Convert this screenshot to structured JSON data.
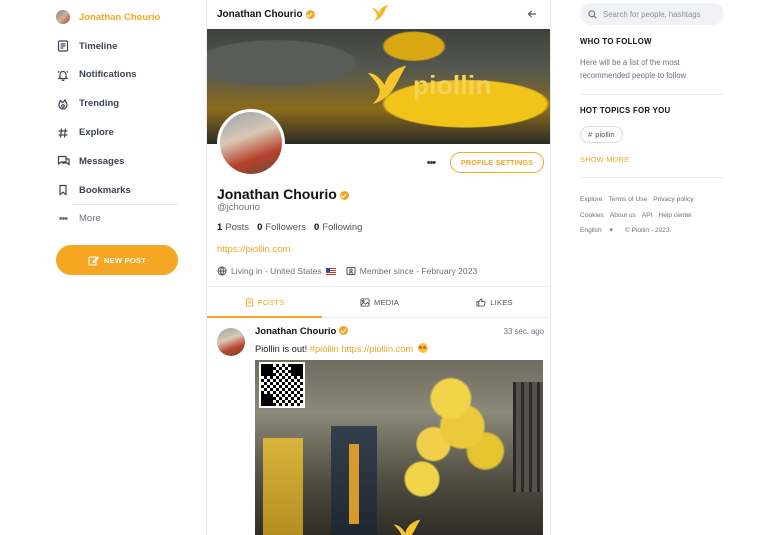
{
  "nav": {
    "profile_name": "Jonathan Chourio",
    "items": [
      {
        "label": "Timeline",
        "icon": "timeline-icon"
      },
      {
        "label": "Notifications",
        "icon": "bell-icon"
      },
      {
        "label": "Trending",
        "icon": "trending-icon"
      },
      {
        "label": "Explore",
        "icon": "hashtag-icon"
      },
      {
        "label": "Messages",
        "icon": "messages-icon"
      },
      {
        "label": "Bookmarks",
        "icon": "bookmark-icon"
      }
    ],
    "more_label": "More",
    "new_post_label": "NEW POST"
  },
  "header": {
    "name": "Jonathan Chourio"
  },
  "cover": {
    "brand": "piollin"
  },
  "profile": {
    "settings_label": "PROFILE SETTINGS",
    "name": "Jonathan Chourio",
    "handle": "@jchourio",
    "posts_count": "1",
    "posts_label": "Posts",
    "followers_count": "0",
    "followers_label": "Followers",
    "following_count": "0",
    "following_label": "Following",
    "website": "https://piollin.com",
    "location": "Living in - United States",
    "member_since": "Member since - February 2023"
  },
  "tabs": [
    {
      "label": "POSTS",
      "active": true
    },
    {
      "label": "MEDIA",
      "active": false
    },
    {
      "label": "LIKES",
      "active": false
    }
  ],
  "post": {
    "author": "Jonathan Chourio",
    "time": "33 sec. ago",
    "text_before": "Piollin is out! ",
    "hashtag": "#piollin",
    "link": "https://piollin.com"
  },
  "sidebar": {
    "search_placeholder": "Search for people, hashtags",
    "who_to_follow_title": "WHO TO FOLLOW",
    "who_to_follow_text": "Here will be a list of the most recommended people to follow",
    "hot_topics_title": "HOT TOPICS FOR YOU",
    "topic": "piollin",
    "show_more": "SHOW MORE",
    "footer_links": [
      "Explore",
      "Terms of Use",
      "Privacy policy",
      "Cookies",
      "About us",
      "API",
      "Help center"
    ],
    "language": "English",
    "copyright": "© Piollin - 2023."
  },
  "colors": {
    "accent": "#f5a623",
    "text": "#1f2328",
    "muted": "#6b7280"
  }
}
